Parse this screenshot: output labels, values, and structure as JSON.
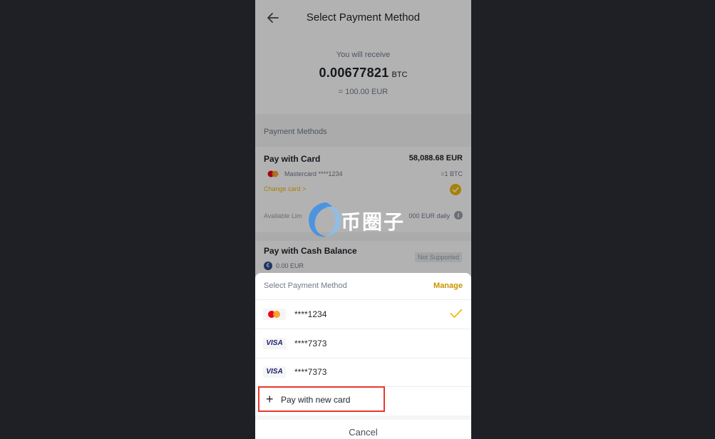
{
  "header": {
    "title": "Select Payment Method",
    "back_icon": "arrow-left-icon"
  },
  "receive": {
    "label": "You will receive",
    "amount": "0.00677821",
    "unit": "BTC",
    "fiat_equivalent": "= 100.00 EUR"
  },
  "payment_methods": {
    "section_label": "Payment Methods",
    "card": {
      "title": "Pay with Card",
      "price": "58,088.68 EUR",
      "brand_text": "Mastercard",
      "masked_number": "****1234",
      "per_unit": "=1 BTC",
      "change_label": "Change card >",
      "available_label": "Available Lim",
      "daily_limit": "000 EUR daily",
      "info_icon": "i"
    },
    "cash": {
      "title": "Pay with Cash Balance",
      "balance": "0.00 EUR",
      "status": "Not Supported",
      "currency_icon": "€"
    }
  },
  "watermark": {
    "text": "币圈子"
  },
  "sheet": {
    "title": "Select Payment Method",
    "manage_label": "Manage",
    "cards": [
      {
        "brand": "mastercard",
        "number": "****1234",
        "selected": true
      },
      {
        "brand": "VISA",
        "number": "****7373",
        "selected": false
      },
      {
        "brand": "VISA",
        "number": "****7373",
        "selected": false
      }
    ],
    "new_card": {
      "icon": "+",
      "label": "Pay with new card"
    },
    "cancel_label": "Cancel"
  },
  "colors": {
    "accent": "#f0b90b",
    "highlight": "#e8382e",
    "background": "#1e2026"
  }
}
